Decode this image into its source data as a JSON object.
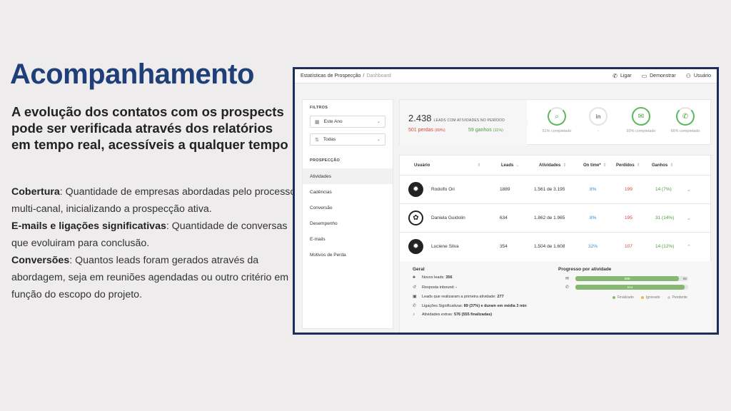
{
  "slide": {
    "title": "Acompanhamento",
    "subtitle": "A evolução dos contatos com os prospects pode ser verificada através dos relatórios em tempo real, acessíveis a qualquer tempo",
    "points": [
      {
        "term": "Cobertura",
        "text": ": Quantidade de empresas abordadas pelo processo multi-canal, inicializando a prospecção ativa."
      },
      {
        "term": "E-mails e ligações significativas",
        "text": ": Quantidade de conversas que evoluiram para conclusão."
      },
      {
        "term": "Conversões",
        "text": ": Quantos leads foram gerados através da abordagem, seja em reuniões agendadas ou outro critério em função do escopo do projeto."
      }
    ]
  },
  "app": {
    "breadcrumb": {
      "root": "Estatísticas de Prospecção",
      "separator": "/",
      "current": "Dashboard"
    },
    "actions": [
      {
        "label": "Ligar",
        "icon": "phone-icon",
        "glyph": "✆"
      },
      {
        "label": "Demonstrar",
        "icon": "monitor-icon",
        "glyph": "▭"
      },
      {
        "label": "Usuário",
        "icon": "user-icon",
        "glyph": "⚇"
      }
    ],
    "filters": {
      "title": "FILTROS",
      "period": "Este Ano",
      "owner": "Todas",
      "section_title": "PROSPECÇÃO",
      "nav": [
        "Atividades",
        "Cadências",
        "Conversão",
        "Desempenho",
        "E-mails",
        "Motivos de Perda"
      ],
      "active_nav": "Atividades"
    },
    "summary": {
      "total": "2.438",
      "total_label": "LEADS COM ATIVIDADES NO PERÍODO",
      "lost": "501 perdas",
      "lost_pct": "(89%)",
      "won": "59 ganhos",
      "won_pct": "(11%)",
      "kpis": [
        {
          "icon": "search-icon",
          "glyph": "⌕",
          "label": "51% completado"
        },
        {
          "icon": "linkedin-icon",
          "glyph": "in",
          "label": "-"
        },
        {
          "icon": "email-icon",
          "glyph": "✉",
          "label": "93% completado"
        },
        {
          "icon": "phone-icon",
          "glyph": "✆",
          "label": "66% completado"
        }
      ]
    },
    "table": {
      "headers": [
        "Usuário",
        "Leads",
        "Atividades",
        "On time*",
        "Perdidos",
        "Ganhos"
      ],
      "rows": [
        {
          "name": "Rodolfo Ori",
          "leads": "1889",
          "activities": "1.561 de 3.195",
          "on_time": "8%",
          "lost": "199",
          "won": "14 (7%)",
          "chevron": "⌄"
        },
        {
          "name": "Daniela Guidolin",
          "leads": "634",
          "activities": "1.862 de 1.965",
          "on_time": "8%",
          "lost": "195",
          "won": "31 (14%)",
          "chevron": "⌄"
        },
        {
          "name": "Luciene Silva",
          "leads": "354",
          "activities": "1.504 de 1.608",
          "on_time": "32%",
          "lost": "107",
          "won": "14 (12%)",
          "chevron": "⌃"
        }
      ]
    },
    "details": {
      "general_title": "Geral",
      "lines": [
        {
          "icon": "new-leads-icon",
          "glyph": "♣",
          "label": "Novos leads: ",
          "value": "356"
        },
        {
          "icon": "inbound-icon",
          "glyph": "↺",
          "label": "Resposta inbound: ",
          "value": "-"
        },
        {
          "icon": "first-activity-icon",
          "glyph": "▣",
          "label": "Leads que realizaram a primeira atividade: ",
          "value": "277"
        },
        {
          "icon": "phone-icon",
          "glyph": "✆",
          "label": "Ligações Significativas: ",
          "value": "89 (37%) e duram em média 3 min"
        },
        {
          "icon": "bell-icon",
          "glyph": "♪",
          "label": "Atividades extras: ",
          "value": "576 (555 finalizadas)"
        }
      ],
      "progress_title": "Progresso por atividade",
      "progress": [
        {
          "icon": "email-icon",
          "glyph": "✉",
          "fill_label": "988",
          "end_label": "82",
          "fill_fraction": 0.92
        },
        {
          "icon": "phone-icon",
          "glyph": "✆",
          "fill_label": "514",
          "end_label": "",
          "fill_fraction": 0.97
        }
      ],
      "legend": [
        {
          "label": "Finalizado",
          "color": "#86b872"
        },
        {
          "label": "Ignorado",
          "color": "#f0b64a"
        },
        {
          "label": "Pendente",
          "color": "#d0d0d0"
        }
      ]
    }
  }
}
